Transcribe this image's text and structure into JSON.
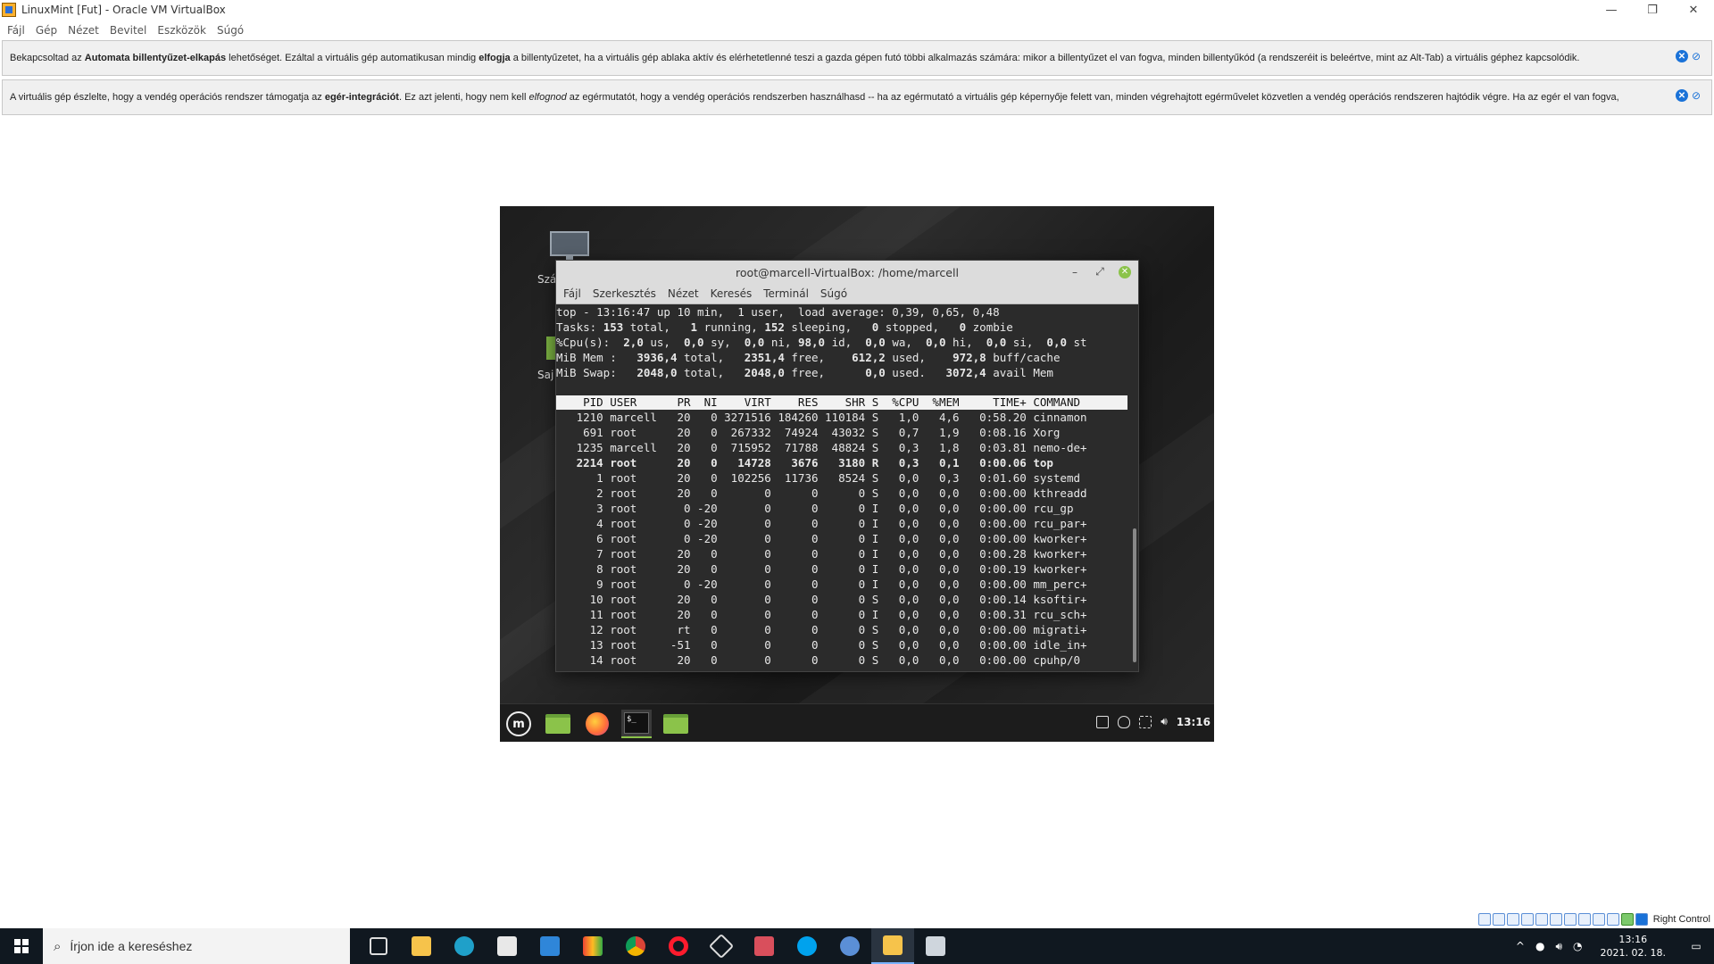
{
  "window": {
    "title": "LinuxMint [Fut] - Oracle VM VirtualBox",
    "minimize": "—",
    "restore": "❐",
    "close": "✕"
  },
  "menu": [
    "Fájl",
    "Gép",
    "Nézet",
    "Bevitel",
    "Eszközök",
    "Súgó"
  ],
  "info_bars": [
    {
      "pre": "Bekapcsoltad az ",
      "bold1": "Automata billentyűzet-elkapás",
      "mid1": " lehetőséget. Ezáltal a virtuális gép automatikusan mindig ",
      "bold2": "elfogja",
      "post": " a billentyűzetet, ha a virtuális gép ablaka aktív és elérhetetlenné teszi a gazda gépen futó többi alkalmazás számára: mikor a billentyűzet el van fogva, minden billentyűkód (a rendszeréit is beleértve, mint az Alt-Tab) a virtuális géphez kapcsolódik."
    },
    {
      "pre": "A virtuális gép észlelte, hogy a vendég operációs rendszer támogatja az ",
      "bold1": "egér-integrációt",
      "mid1": ". Ez azt jelenti, hogy nem kell ",
      "italic": "elfognod",
      "post": " az egérmutatót, hogy a vendég operációs rendszerben használhasd -- ha az egérmutató a virtuális gép képernyője felett van, minden végrehajtott egérművelet közvetlen a vendég operációs rendszeren hajtódik végre. Ha az egér el van fogva,"
    }
  ],
  "desktop": {
    "label1": "Szá",
    "label2": "Saj"
  },
  "terminal": {
    "title": "root@marcell-VirtualBox: /home/marcell",
    "menu": [
      "Fájl",
      "Szerkesztés",
      "Nézet",
      "Keresés",
      "Terminál",
      "Súgó"
    ],
    "summary": {
      "l1": "top - 13:16:47 up 10 min,  1 user,  load average: 0,39, 0,65, 0,48",
      "l2a": "Tasks: ",
      "l2b": "153",
      "l2c": " total,   ",
      "l2d": "1",
      "l2e": " running, ",
      "l2f": "152",
      "l2g": " sleeping,   ",
      "l2h": "0",
      "l2i": " stopped,   ",
      "l2j": "0",
      "l2k": " zombie",
      "l3a": "%Cpu(s):  ",
      "l3b": "2,0",
      "l3c": " us,  ",
      "l3d": "0,0",
      "l3e": " sy,  ",
      "l3f": "0,0",
      "l3g": " ni, ",
      "l3h": "98,0",
      "l3i": " id,  ",
      "l3j": "0,0",
      "l3k": " wa,  ",
      "l3l": "0,0",
      "l3m": " hi,  ",
      "l3n": "0,0",
      "l3o": " si,  ",
      "l3p": "0,0",
      "l3q": " st",
      "l4a": "MiB Mem :   ",
      "l4b": "3936,4",
      "l4c": " total,   ",
      "l4d": "2351,4",
      "l4e": " free,    ",
      "l4f": "612,2",
      "l4g": " used,    ",
      "l4h": "972,8",
      "l4i": " buff/cache",
      "l5a": "MiB Swap:   ",
      "l5b": "2048,0",
      "l5c": " total,   ",
      "l5d": "2048,0",
      "l5e": " free,      ",
      "l5f": "0,0",
      "l5g": " used.   ",
      "l5h": "3072,4",
      "l5i": " avail Mem"
    },
    "header": "    PID USER      PR  NI    VIRT    RES    SHR S  %CPU  %MEM     TIME+ COMMAND    ",
    "processes": [
      {
        "text": "   1210 marcell   20   0 3271516 184260 110184 S   1,0   4,6   0:58.20 cinnamon",
        "bold": false
      },
      {
        "text": "    691 root      20   0  267332  74924  43032 S   0,7   1,9   0:08.16 Xorg",
        "bold": false
      },
      {
        "text": "   1235 marcell   20   0  715952  71788  48824 S   0,3   1,8   0:03.81 nemo-de+",
        "bold": false
      },
      {
        "text": "   2214 root      20   0   14728   3676   3180 R   0,3   0,1   0:00.06 top",
        "bold": true
      },
      {
        "text": "      1 root      20   0  102256  11736   8524 S   0,0   0,3   0:01.60 systemd",
        "bold": false
      },
      {
        "text": "      2 root      20   0       0      0      0 S   0,0   0,0   0:00.00 kthreadd",
        "bold": false
      },
      {
        "text": "      3 root       0 -20       0      0      0 I   0,0   0,0   0:00.00 rcu_gp",
        "bold": false
      },
      {
        "text": "      4 root       0 -20       0      0      0 I   0,0   0,0   0:00.00 rcu_par+",
        "bold": false
      },
      {
        "text": "      6 root       0 -20       0      0      0 I   0,0   0,0   0:00.00 kworker+",
        "bold": false
      },
      {
        "text": "      7 root      20   0       0      0      0 I   0,0   0,0   0:00.28 kworker+",
        "bold": false
      },
      {
        "text": "      8 root      20   0       0      0      0 I   0,0   0,0   0:00.19 kworker+",
        "bold": false
      },
      {
        "text": "      9 root       0 -20       0      0      0 I   0,0   0,0   0:00.00 mm_perc+",
        "bold": false
      },
      {
        "text": "     10 root      20   0       0      0      0 S   0,0   0,0   0:00.14 ksoftir+",
        "bold": false
      },
      {
        "text": "     11 root      20   0       0      0      0 I   0,0   0,0   0:00.31 rcu_sch+",
        "bold": false
      },
      {
        "text": "     12 root      rt   0       0      0      0 S   0,0   0,0   0:00.00 migrati+",
        "bold": false
      },
      {
        "text": "     13 root     -51   0       0      0      0 S   0,0   0,0   0:00.00 idle_in+",
        "bold": false
      },
      {
        "text": "     14 root      20   0       0      0      0 S   0,0   0,0   0:00.00 cpuhp/0",
        "bold": false
      }
    ]
  },
  "guest_panel": {
    "menu_icon_glyph": "m",
    "term_icon_glyph": "$_",
    "clock": "13:16"
  },
  "host_status": {
    "host_key": "Right Control"
  },
  "taskbar": {
    "search_placeholder": "Írjon ide a kereséshez",
    "time": "13:16",
    "date": "2021. 02. 18.",
    "tray_chevron": "^"
  },
  "colors": {
    "accent_mint": "#8bc34a",
    "vbox_blue": "#1a72d8",
    "taskbar": "#101820"
  }
}
